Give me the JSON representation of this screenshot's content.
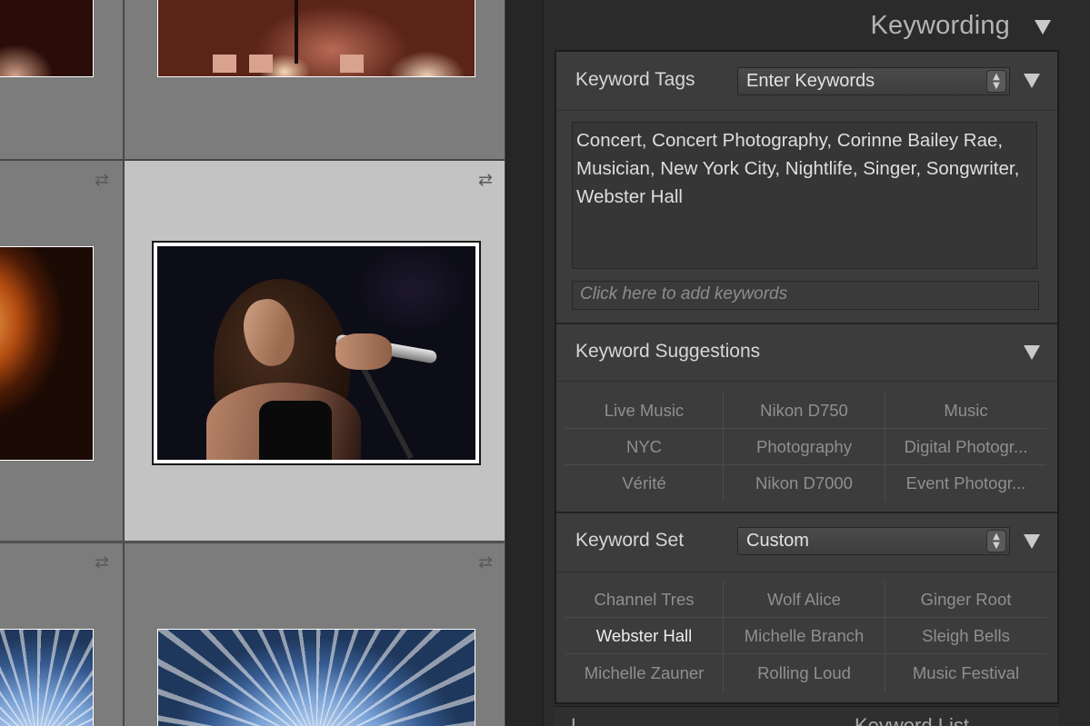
{
  "panel": {
    "title": "Keywording"
  },
  "keyword_tags": {
    "label": "Keyword Tags",
    "dropdown_value": "Enter Keywords",
    "text": "Concert, Concert Photography, Corinne Bailey Rae, Musician, New York City, Nightlife, Singer, Songwriter, Webster Hall",
    "add_placeholder": "Click here to add keywords"
  },
  "keyword_suggestions": {
    "label": "Keyword Suggestions",
    "items": [
      "Live Music",
      "Nikon D750",
      "Music",
      "NYC",
      "Photography",
      "Digital Photogr...",
      "Vérité",
      "Nikon D7000",
      "Event Photogr..."
    ]
  },
  "keyword_set": {
    "label": "Keyword Set",
    "dropdown_value": "Custom",
    "items": [
      "Channel Tres",
      "Wolf Alice",
      "Ginger Root",
      "Webster Hall",
      "Michelle Branch",
      "Sleigh Bells",
      "Michelle Zauner",
      "Rolling Loud",
      "Music Festival"
    ],
    "active_item": "Webster Hall"
  },
  "next_panel": {
    "left_text": "L",
    "right_text": "Keyword List"
  },
  "grid": {
    "sync_symbol": "⇄"
  },
  "colors": {
    "panel_bg": "#3c3c3c",
    "grid_bg": "#7c7c7c",
    "selected_cell_bg": "#c3c3c3",
    "text": "#d6d6d6",
    "muted_text": "#8f8f8f"
  }
}
